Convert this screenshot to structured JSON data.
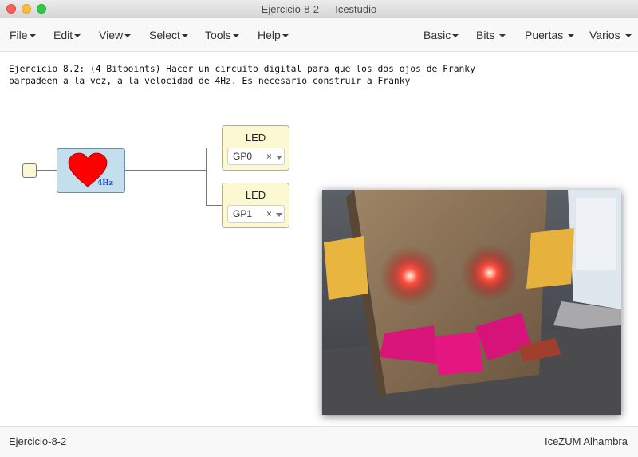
{
  "window": {
    "title": "Ejercicio-8-2 — Icestudio"
  },
  "menus_left": [
    "File",
    "Edit",
    "View",
    "Select",
    "Tools",
    "Help"
  ],
  "menus_right": [
    "Basic",
    "Bits",
    "Puertas",
    "Varios"
  ],
  "description": "Ejercicio 8.2: (4 Bitpoints) Hacer un circuito digital para que los dos ojos de Franky\nparpadeen a la vez, a la velocidad de 4Hz. Es necesario construir a Franky",
  "heart_block": {
    "label": "4Hz",
    "icon": "heart-icon",
    "color": "#ff0000"
  },
  "leds": [
    {
      "title": "LED",
      "value": "GP0",
      "clear": "×"
    },
    {
      "title": "LED",
      "value": "GP1",
      "clear": "×"
    }
  ],
  "photo": {
    "subject": "franky-cardboard-box-with-red-led-eyes"
  },
  "status": {
    "left": "Ejercicio-8-2",
    "right": "IceZUM Alhambra"
  }
}
